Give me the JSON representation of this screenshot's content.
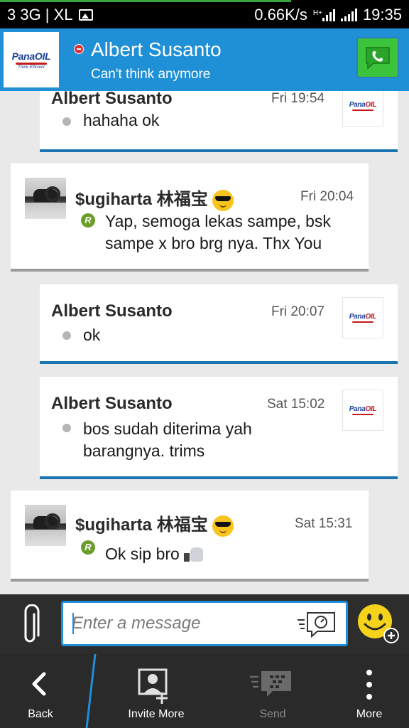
{
  "status_bar": {
    "left_text": "3 3G | XL",
    "speed": "0.66K/s",
    "network_type": "H+",
    "time": "19:35",
    "icons": [
      "image-notification-icon",
      "mobile-data-signal-icon",
      "wifi-signal-icon"
    ]
  },
  "header": {
    "contact_name": "Albert Susanto",
    "status_message": "Can't think anymore",
    "avatar_logo": {
      "brand": "PanaOIL",
      "tagline": "Think Efficient"
    },
    "presence": "busy",
    "call_button_icon": "phone-icon",
    "colors": {
      "header_bg": "#1f8fd6",
      "call_green": "#3cc33c"
    }
  },
  "messages": [
    {
      "sender": "Albert Susanto",
      "time": "Fri 19:54",
      "text": "hahaha ok",
      "direction": "out"
    },
    {
      "sender": "$ugiharta 林福宝",
      "time": "Fri 20:04",
      "text": "Yap, semoga lekas sampe, bsk sampe x bro brg nya. Thx You",
      "direction": "in",
      "read_badge": "R",
      "emoji": "cool-sunglasses"
    },
    {
      "sender": "Albert Susanto",
      "time": "Fri 20:07",
      "text": "ok",
      "direction": "out"
    },
    {
      "sender": "Albert Susanto",
      "time": "Sat 15:02",
      "text": "bos sudah diterima yah barangnya. trims",
      "direction": "out"
    },
    {
      "sender": "$ugiharta 林福宝",
      "time": "Sat 15:31",
      "text": "Ok sip bro",
      "direction": "in",
      "read_badge": "R",
      "emoji": "cool-sunglasses",
      "trailing_emoji": "thumbs-up"
    }
  ],
  "composer": {
    "placeholder": "Enter a message",
    "value": "",
    "attach_icon": "paperclip-icon",
    "voice_icon": "speech-bubble-icon",
    "emoticon_icon": "smiley-add-icon"
  },
  "nav": {
    "items": [
      {
        "label": "Back",
        "icon": "chevron-left-icon",
        "enabled": true
      },
      {
        "label": "Invite More",
        "icon": "add-contact-icon",
        "enabled": true
      },
      {
        "label": "Send",
        "icon": "bbm-send-icon",
        "enabled": false
      },
      {
        "label": "More",
        "icon": "more-vertical-icon",
        "enabled": true
      }
    ]
  }
}
